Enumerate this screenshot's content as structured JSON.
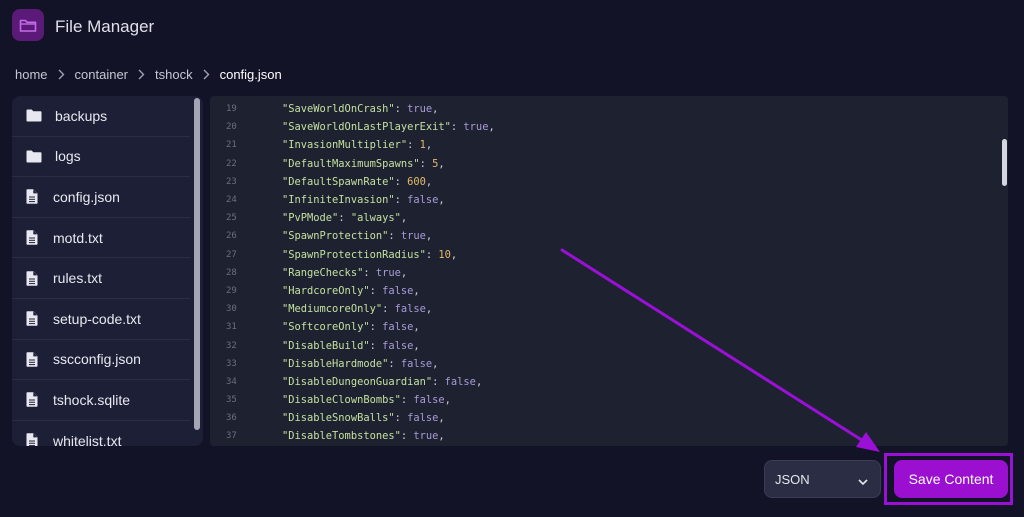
{
  "header": {
    "title": "File Manager",
    "icon": "folder-icon"
  },
  "breadcrumb": {
    "items": [
      "home",
      "container",
      "tshock"
    ],
    "current": "config.json"
  },
  "sidebar": {
    "items": [
      {
        "label": "backups",
        "type": "folder"
      },
      {
        "label": "logs",
        "type": "folder"
      },
      {
        "label": "config.json",
        "type": "file"
      },
      {
        "label": "motd.txt",
        "type": "file"
      },
      {
        "label": "rules.txt",
        "type": "file"
      },
      {
        "label": "setup-code.txt",
        "type": "file"
      },
      {
        "label": "sscconfig.json",
        "type": "file"
      },
      {
        "label": "tshock.sqlite",
        "type": "file"
      },
      {
        "label": "whitelist.txt",
        "type": "file"
      }
    ]
  },
  "editor": {
    "lines": [
      {
        "n": "19",
        "key": "\"SaveWorldOnCrash\"",
        "value": "true",
        "vtype": "bool"
      },
      {
        "n": "20",
        "key": "\"SaveWorldOnLastPlayerExit\"",
        "value": "true",
        "vtype": "bool"
      },
      {
        "n": "21",
        "key": "\"InvasionMultiplier\"",
        "value": "1",
        "vtype": "num"
      },
      {
        "n": "22",
        "key": "\"DefaultMaximumSpawns\"",
        "value": "5",
        "vtype": "num"
      },
      {
        "n": "23",
        "key": "\"DefaultSpawnRate\"",
        "value": "600",
        "vtype": "num"
      },
      {
        "n": "24",
        "key": "\"InfiniteInvasion\"",
        "value": "false",
        "vtype": "bool"
      },
      {
        "n": "25",
        "key": "\"PvPMode\"",
        "value": "\"always\"",
        "vtype": "str"
      },
      {
        "n": "26",
        "key": "\"SpawnProtection\"",
        "value": "true",
        "vtype": "bool"
      },
      {
        "n": "27",
        "key": "\"SpawnProtectionRadius\"",
        "value": "10",
        "vtype": "num"
      },
      {
        "n": "28",
        "key": "\"RangeChecks\"",
        "value": "true",
        "vtype": "bool"
      },
      {
        "n": "29",
        "key": "\"HardcoreOnly\"",
        "value": "false",
        "vtype": "bool"
      },
      {
        "n": "30",
        "key": "\"MediumcoreOnly\"",
        "value": "false",
        "vtype": "bool"
      },
      {
        "n": "31",
        "key": "\"SoftcoreOnly\"",
        "value": "false",
        "vtype": "bool"
      },
      {
        "n": "32",
        "key": "\"DisableBuild\"",
        "value": "false",
        "vtype": "bool"
      },
      {
        "n": "33",
        "key": "\"DisableHardmode\"",
        "value": "false",
        "vtype": "bool"
      },
      {
        "n": "34",
        "key": "\"DisableDungeonGuardian\"",
        "value": "false",
        "vtype": "bool"
      },
      {
        "n": "35",
        "key": "\"DisableClownBombs\"",
        "value": "false",
        "vtype": "bool"
      },
      {
        "n": "36",
        "key": "\"DisableSnowBalls\"",
        "value": "false",
        "vtype": "bool"
      },
      {
        "n": "37",
        "key": "\"DisableTombstones\"",
        "value": "true",
        "vtype": "bool"
      }
    ]
  },
  "controls": {
    "language_select": "JSON",
    "save_label": "Save Content"
  },
  "colors": {
    "accent": "#9a0fd0",
    "background": "#121326",
    "panel": "#1d1f36",
    "editor_bg": "#1e2230"
  }
}
